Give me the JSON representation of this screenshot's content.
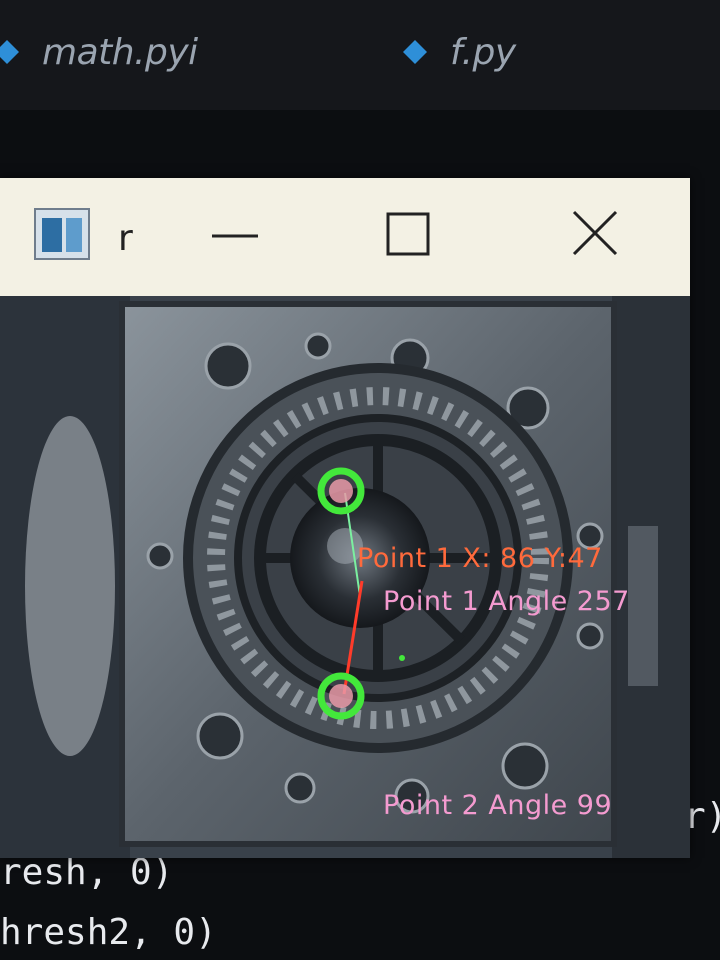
{
  "editor": {
    "tabs": [
      {
        "label": "math.pyi"
      },
      {
        "label": "f.py"
      }
    ],
    "code_lines": [
      "resh, 0)",
      "hresh2, 0)"
    ],
    "code_fragment_right": "r)"
  },
  "window": {
    "title": "r",
    "controls": {
      "minimize": "minimize-icon",
      "maximize": "maximize-icon",
      "close": "close-icon"
    }
  },
  "overlay": {
    "point1_coords": "Point 1 X: 86  Y:47",
    "point1_angle": "Point 1 Angle 257",
    "point2_angle": "Point 2 Angle 99"
  },
  "colors": {
    "coords_text": "#ff6a3c",
    "angle_text": "#f49bd0",
    "marker": "#43e83b",
    "line_red": "#ff3b2a",
    "line_green": "#7bf0a0",
    "tab_icon": "#2e8fd8"
  }
}
